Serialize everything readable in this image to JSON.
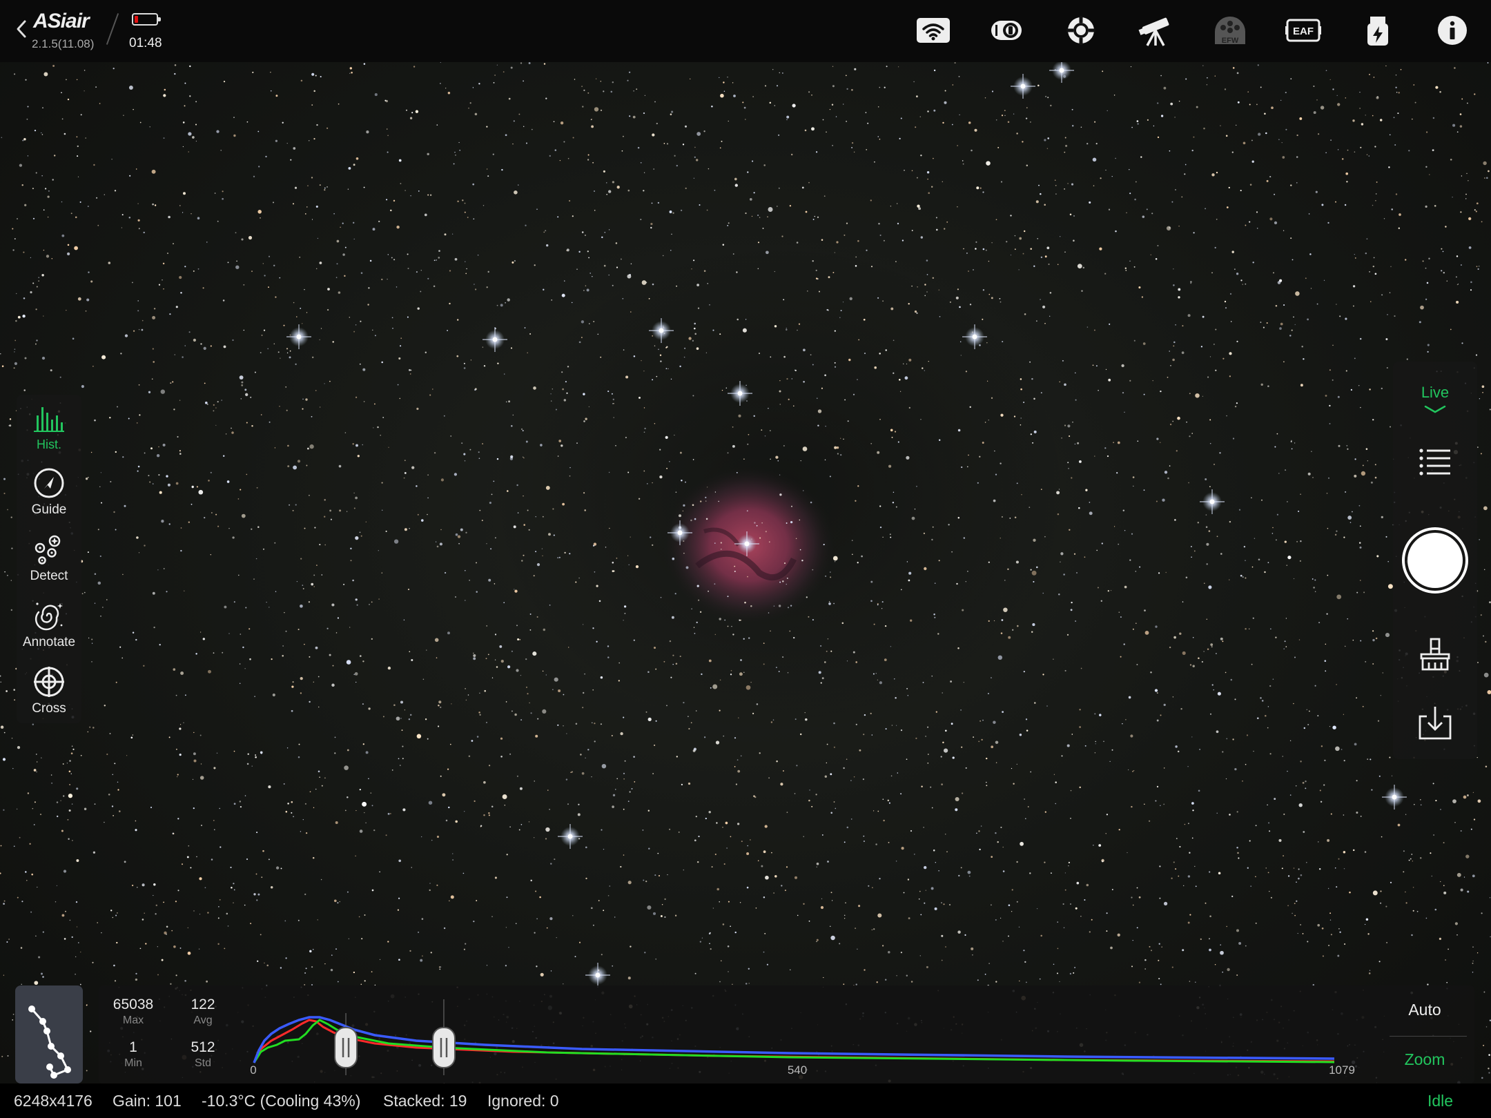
{
  "header": {
    "app_name": "ASiair",
    "version": "2.1.5(11.08)",
    "time": "01:48",
    "battery_level": 0.15,
    "icons": [
      "wifi-icon",
      "camera-icon",
      "guide-scope-icon",
      "telescope-icon",
      "efw-icon",
      "eaf-icon",
      "usb-power-icon",
      "info-icon"
    ],
    "efw_label": "EFW",
    "eaf_label": "EAF"
  },
  "left_toolbar": {
    "items": [
      {
        "label": "Hist.",
        "icon": "histogram-icon",
        "active": true
      },
      {
        "label": "Guide",
        "icon": "guide-compass-icon",
        "active": false
      },
      {
        "label": "Detect",
        "icon": "detect-stars-icon",
        "active": false
      },
      {
        "label": "Annotate",
        "icon": "annotate-galaxy-icon",
        "active": false
      },
      {
        "label": "Cross",
        "icon": "crosshair-icon",
        "active": false
      }
    ]
  },
  "right_toolbar": {
    "mode": "Live",
    "icons": [
      "list-icon",
      "shutter-button",
      "clear-brush-icon",
      "save-download-icon"
    ]
  },
  "histogram": {
    "max": "65038",
    "max_label": "Max",
    "avg": "122",
    "avg_label": "Avg",
    "min": "1",
    "min_label": "Min",
    "std": "512",
    "std_label": "Std",
    "axis_ticks": [
      "0",
      "540",
      "1079"
    ],
    "auto_label": "Auto",
    "zoom_label": "Zoom",
    "black_point": 0.085,
    "white_point": 0.175
  },
  "status": {
    "resolution": "6248x4176",
    "gain": "Gain: 101",
    "temperature": "-10.3°C (Cooling 43%)",
    "stacked": "Stacked: 19",
    "ignored": "Ignored: 0",
    "state": "Idle"
  },
  "colors": {
    "accent": "#22c55e",
    "battery_low": "#e11111",
    "hist_red": "#ff2a2a",
    "hist_green": "#22dd22",
    "hist_blue": "#3a5bff"
  }
}
